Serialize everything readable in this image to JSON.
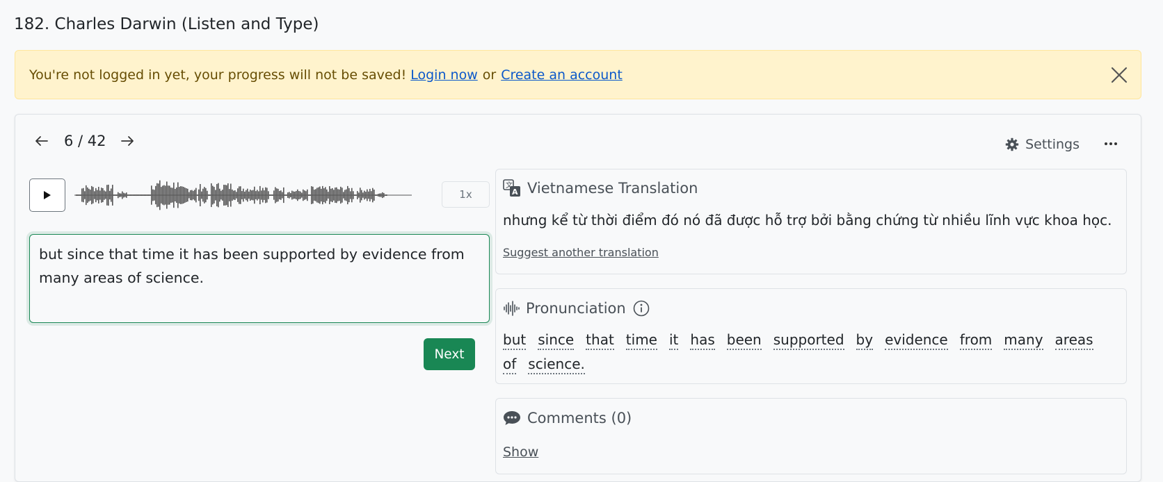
{
  "page": {
    "title": "182. Charles Darwin (Listen and Type)"
  },
  "alert": {
    "message": "You're not logged in yet, your progress will not be saved!",
    "login_label": "Login now",
    "or_label": "or",
    "create_label": "Create an account",
    "close_icon": "close-icon"
  },
  "nav": {
    "prev_icon": "arrow-left-icon",
    "counter": "6 / 42",
    "next_icon": "arrow-right-icon",
    "settings_label": "Settings",
    "settings_icon": "gear-icon",
    "more_icon": "more-horizontal-icon"
  },
  "player": {
    "play_icon": "play-icon",
    "speed_label": "1x"
  },
  "answer": {
    "value": "but since that time it has been supported by evidence from many areas of science."
  },
  "next_button": {
    "label": "Next"
  },
  "translation": {
    "title": "Vietnamese Translation",
    "icon": "translate-icon",
    "text": "nhưng kể từ thời điểm đó nó đã được hỗ trợ bởi bằng chứng từ nhiều lĩnh vực khoa học.",
    "suggest_label": "Suggest another translation"
  },
  "pronunciation": {
    "title": "Pronunciation",
    "icon": "soundwave-icon",
    "info_icon": "info-icon",
    "words": [
      "but",
      "since",
      "that",
      "time",
      "it",
      "has",
      "been",
      "supported",
      "by",
      "evidence",
      "from",
      "many",
      "areas",
      "of",
      "science."
    ]
  },
  "comments": {
    "title": "Comments (0)",
    "icon": "chat-icon",
    "show_label": "Show"
  },
  "colors": {
    "accent": "#198754",
    "alert_bg": "#fff3cd",
    "link": "#0a58ca"
  }
}
